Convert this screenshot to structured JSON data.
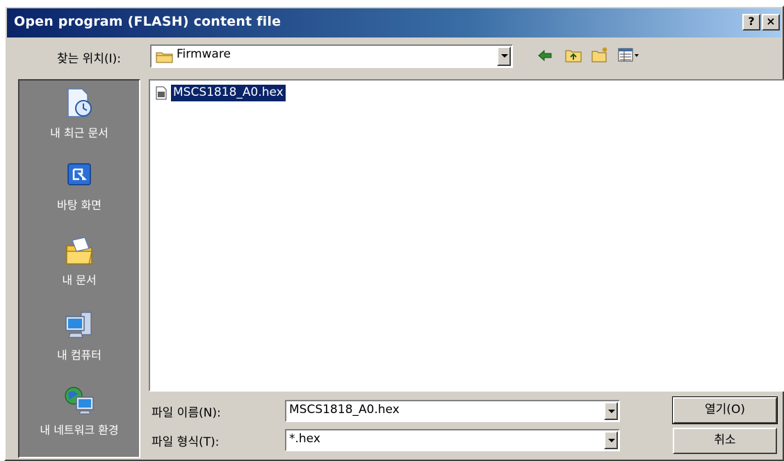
{
  "window": {
    "title": "Open program (FLASH) content file",
    "help_label": "?",
    "close_label": "×"
  },
  "lookin": {
    "label": "찾는 위치(I):",
    "value": "Firmware"
  },
  "toolbar": {
    "icons": [
      "back-icon",
      "up-folder-icon",
      "new-folder-icon",
      "view-menu-icon"
    ]
  },
  "places": [
    {
      "label": "내 최근 문서",
      "icon": "recent-documents-icon"
    },
    {
      "label": "바탕 화면",
      "icon": "desktop-icon"
    },
    {
      "label": "내 문서",
      "icon": "my-documents-icon"
    },
    {
      "label": "내 컴퓨터",
      "icon": "my-computer-icon"
    },
    {
      "label": "내 네트워크 환경",
      "icon": "network-places-icon"
    }
  ],
  "files": [
    {
      "name": "MSCS1818_A0.hex",
      "icon": "hex-file-icon",
      "selected": true
    }
  ],
  "filename": {
    "label": "파일 이름(N):",
    "value": "MSCS1818_A0.hex"
  },
  "filetype": {
    "label": "파일 형식(T):",
    "value": "*.hex"
  },
  "buttons": {
    "open": "열기(O)",
    "cancel": "취소"
  },
  "colors": {
    "title_start": "#0a246a",
    "title_end": "#a6caf0",
    "face": "#d4d0c8",
    "places_bg": "#808080",
    "selection": "#0a246a"
  }
}
